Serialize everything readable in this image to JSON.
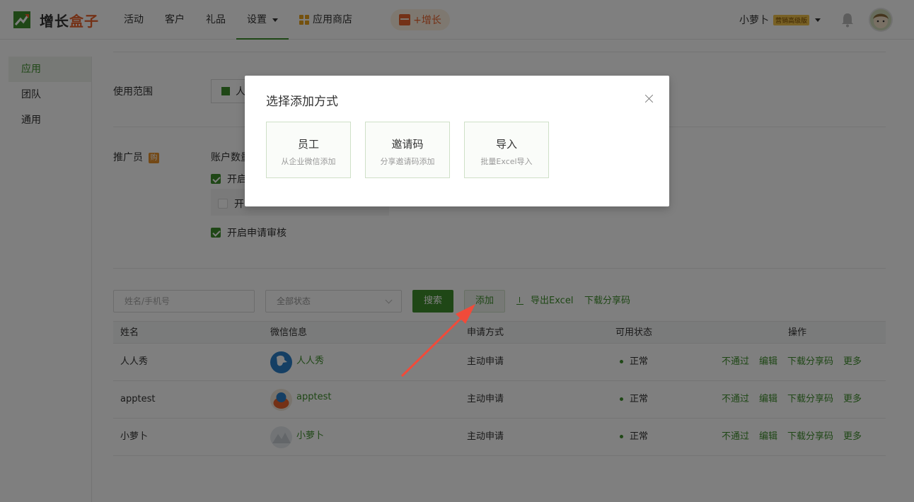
{
  "header": {
    "logo_part1": "增长",
    "logo_part2": "盒子",
    "nav": [
      {
        "label": "活动"
      },
      {
        "label": "客户"
      },
      {
        "label": "礼品"
      },
      {
        "label": "设置"
      },
      {
        "label": "应用商店"
      }
    ],
    "grow_label": "+增长",
    "user_name": "小萝卜",
    "user_badge": "营销高级版"
  },
  "sidebar": {
    "items": [
      {
        "label": "应用"
      },
      {
        "label": "团队"
      },
      {
        "label": "通用"
      }
    ]
  },
  "form": {
    "scope_label": "使用范围",
    "scope_value": "人",
    "promoter_label": "推广员",
    "promoter_icon_char": "购",
    "account_label": "账户数量",
    "option1_label": "开启",
    "option2_label": "开",
    "review_label": "开启申请审核"
  },
  "toolbar": {
    "search_placeholder": "姓名/手机号",
    "status_value": "全部状态",
    "search_button": "搜索",
    "add_button": "添加",
    "export_label": "导出Excel",
    "download_code_label": "下载分享码"
  },
  "table": {
    "headers": {
      "name": "姓名",
      "wechat": "微信信息",
      "apply": "申请方式",
      "status": "可用状态",
      "ops": "操作"
    },
    "rows": [
      {
        "name": "人人秀",
        "wechat": "人人秀",
        "apply": "主动申请",
        "status": "正常"
      },
      {
        "name": "apptest",
        "wechat": "apptest",
        "apply": "主动申请",
        "status": "正常"
      },
      {
        "name": "小萝卜",
        "wechat": "小萝卜",
        "apply": "主动申请",
        "status": "正常"
      }
    ],
    "op_labels": {
      "reject": "不通过",
      "edit": "编辑",
      "download": "下载分享码",
      "more": "更多"
    }
  },
  "modal": {
    "title": "选择添加方式",
    "options": [
      {
        "title": "员工",
        "subtitle": "从企业微信添加"
      },
      {
        "title": "邀请码",
        "subtitle": "分享邀请码添加"
      },
      {
        "title": "导入",
        "subtitle": "批量Excel导入"
      }
    ]
  },
  "colors": {
    "accent": "#3f8f2d",
    "brand_orange": "#e8622c",
    "status_dot": "#3f8f2d"
  }
}
